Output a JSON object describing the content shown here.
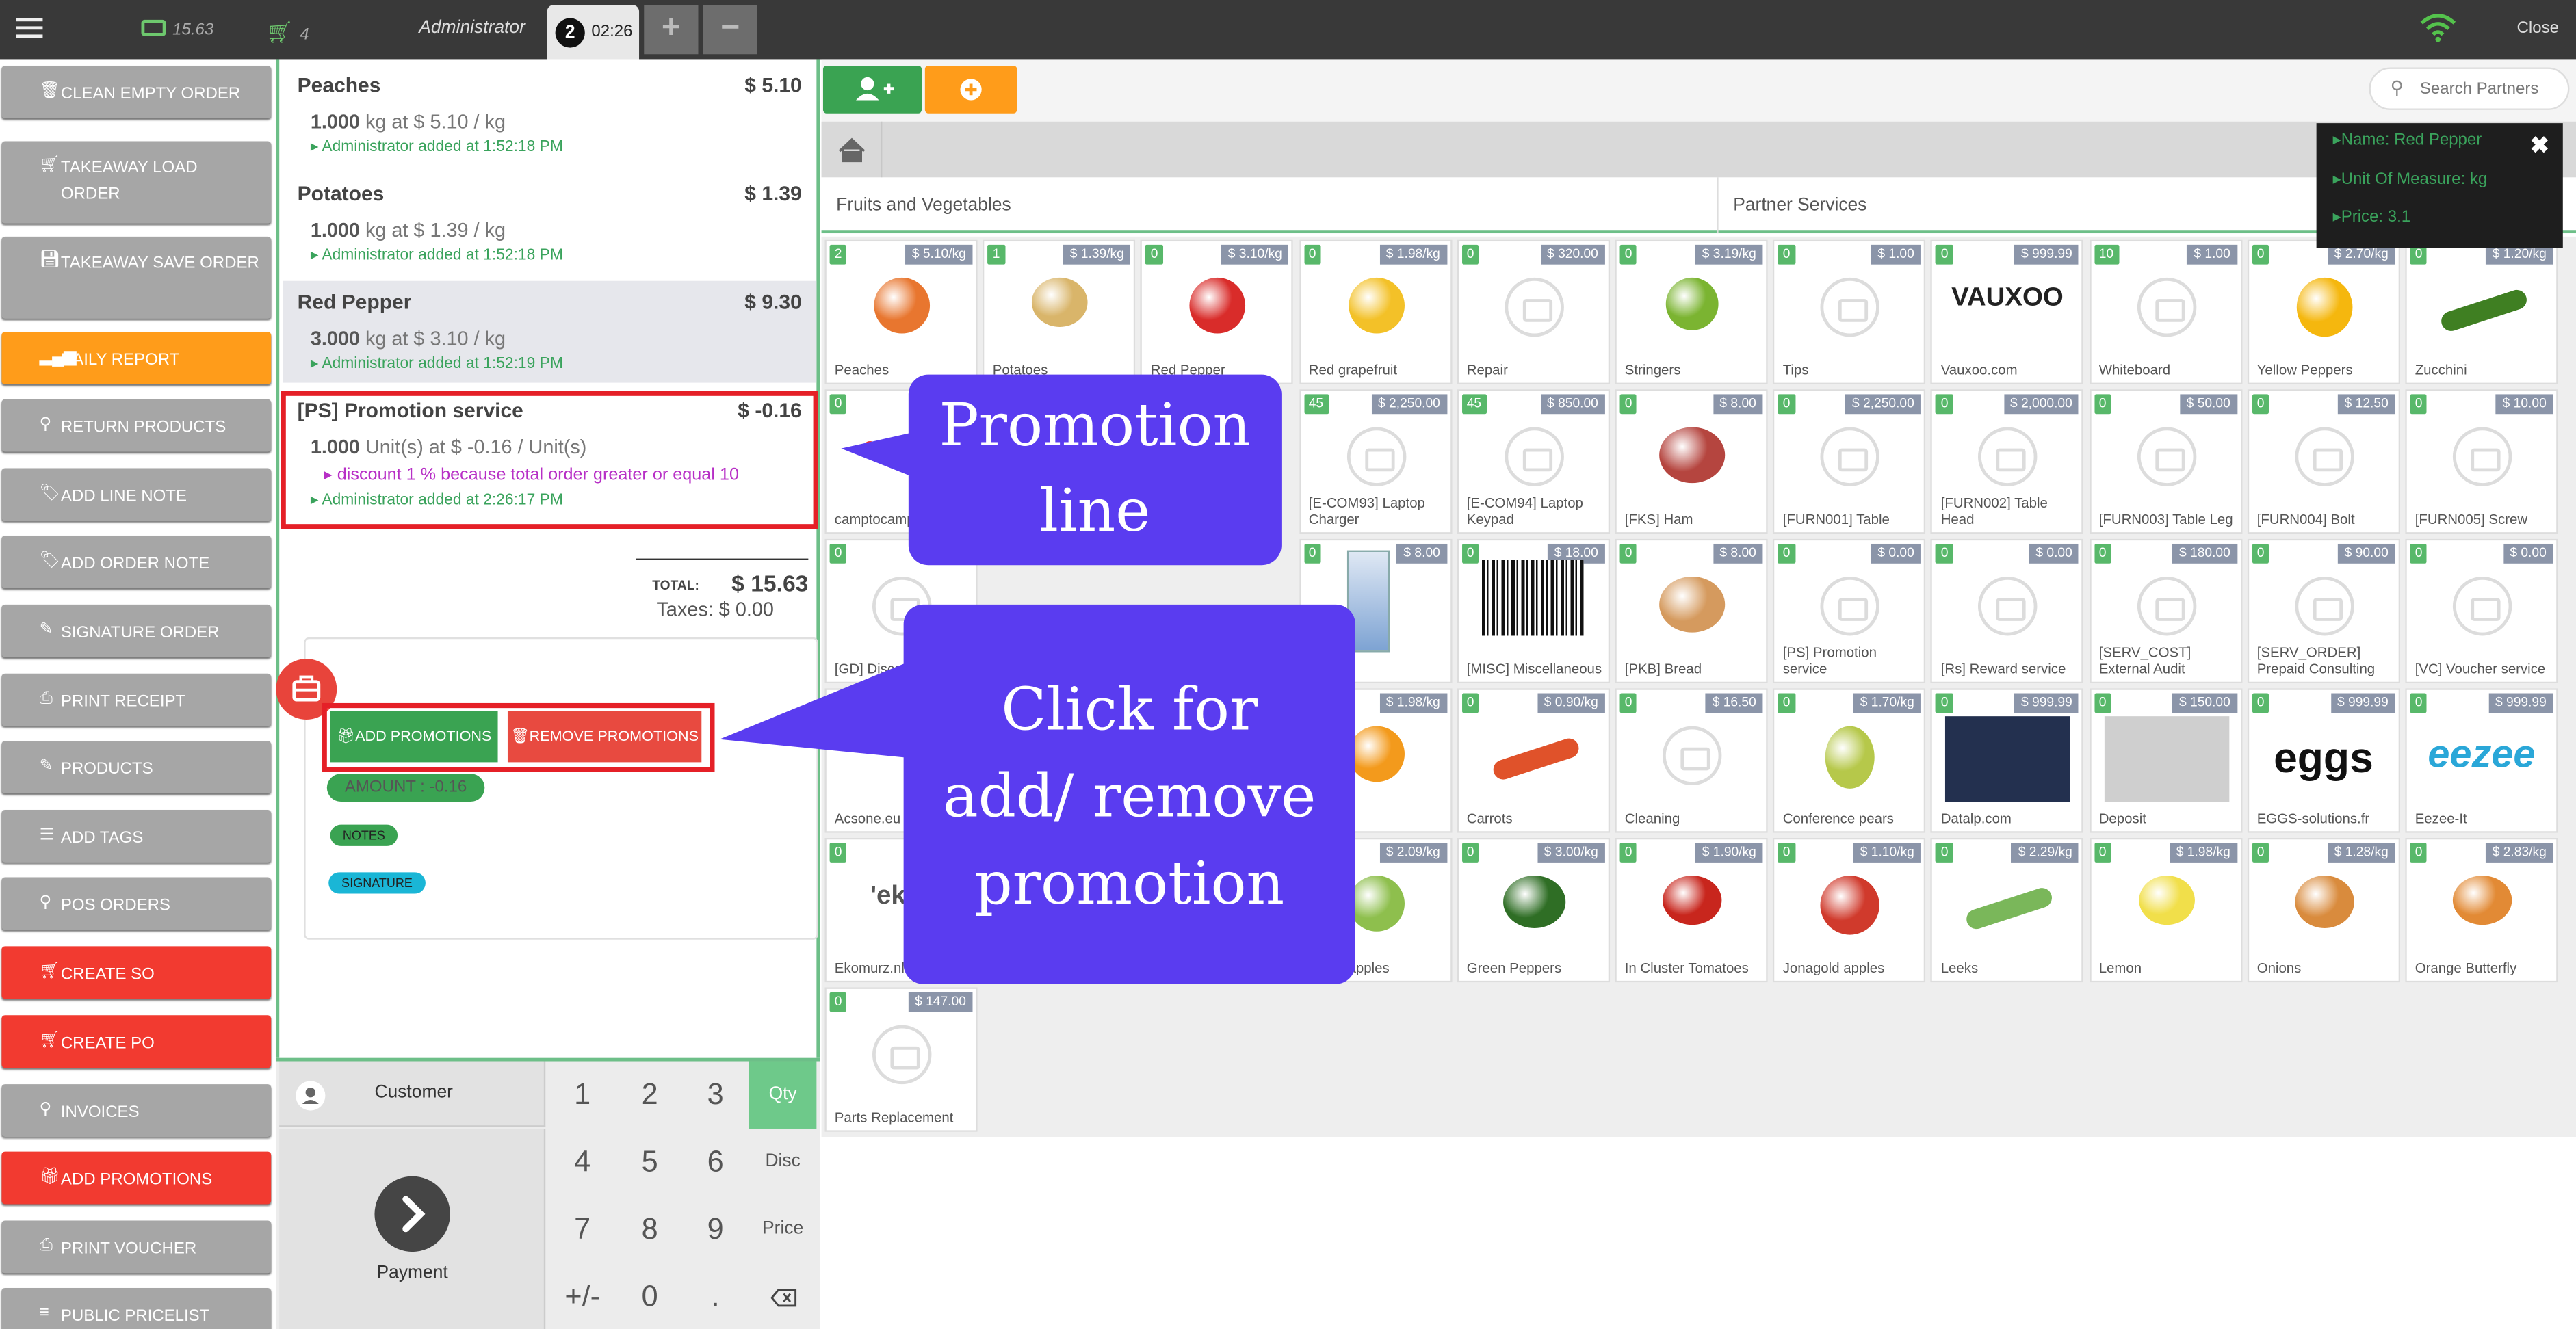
{
  "topbar": {
    "cash_value": "15.63",
    "cart_count": "4",
    "user": "Administrator",
    "order_number": "2",
    "order_time": "02:26",
    "add_tab": "+",
    "remove_tab": "−",
    "close_label": "Close"
  },
  "sidebar": {
    "items": [
      {
        "label": "CLEAN EMPTY ORDER",
        "icon": "trash-icon"
      },
      {
        "label": "TAKEAWAY LOAD ORDER",
        "icon": "cart-icon"
      },
      {
        "label": "TAKEAWAY SAVE ORDER",
        "icon": "save-icon"
      },
      {
        "label": "DAILY REPORT",
        "icon": "chart-icon"
      },
      {
        "label": "RETURN PRODUCTS",
        "icon": "search-icon"
      },
      {
        "label": "ADD LINE NOTE",
        "icon": "tag-icon"
      },
      {
        "label": "ADD ORDER NOTE",
        "icon": "tag-icon"
      },
      {
        "label": "SIGNATURE ORDER",
        "icon": "edit-icon"
      },
      {
        "label": "PRINT RECEIPT",
        "icon": "print-icon"
      },
      {
        "label": "PRODUCTS",
        "icon": "edit-icon"
      },
      {
        "label": "ADD TAGS",
        "icon": "sliders-icon"
      },
      {
        "label": "POS ORDERS",
        "icon": "search-icon"
      },
      {
        "label": "CREATE SO",
        "icon": "cart-icon"
      },
      {
        "label": "CREATE PO",
        "icon": "cart-icon"
      },
      {
        "label": "INVOICES",
        "icon": "search-icon"
      },
      {
        "label": "ADD PROMOTIONS",
        "icon": "gift-icon"
      },
      {
        "label": "PRINT VOUCHER",
        "icon": "print-icon"
      },
      {
        "label": "PUBLIC PRICELIST",
        "icon": "list-icon"
      }
    ]
  },
  "order": {
    "lines": [
      {
        "name": "Peaches",
        "price": "$ 5.10",
        "qty": "1.000",
        "qty_text": "kg at $ 5.10 / kg",
        "note": "Administrator added at 1:52:18 PM"
      },
      {
        "name": "Potatoes",
        "price": "$ 1.39",
        "qty": "1.000",
        "qty_text": "kg at $ 1.39 / kg",
        "note": "Administrator added at 1:52:18 PM"
      },
      {
        "name": "Red Pepper",
        "price": "$ 9.30",
        "qty": "3.000",
        "qty_text": "kg at $ 3.10 / kg",
        "note": "Administrator added at 1:52:19 PM"
      },
      {
        "name": "[PS] Promotion service",
        "price": "$ -0.16",
        "qty": "1.000",
        "qty_text": "Unit(s) at $ -0.16 / Unit(s)",
        "discount": "discount 1 % because total order greater or equal 10",
        "note": "Administrator added at 2:26:17 PM"
      }
    ],
    "total_label": "TOTAL:",
    "total": "$ 15.63",
    "taxes": "Taxes: $ 0.00",
    "add_promotions": "ADD PROMOTIONS",
    "remove_promotions": "REMOVE PROMOTIONS",
    "amount": "AMOUNT : -0.16",
    "notes": "NOTES",
    "signature": "SIGNATURE"
  },
  "numpad": {
    "customer": "Customer",
    "payment": "Payment",
    "keys": [
      "1",
      "2",
      "3",
      "4",
      "5",
      "6",
      "7",
      "8",
      "9",
      "+/-",
      "0",
      "."
    ],
    "qty": "Qty",
    "disc": "Disc",
    "price": "Price"
  },
  "products_panel": {
    "search_placeholder": "Search Partners",
    "categories": [
      "Fruits and Vegetables",
      "Partner Services"
    ],
    "tooltip": {
      "name": "Name: Red Pepper",
      "uom": "Unit Of Measure: kg",
      "price": "Price: 3.1"
    },
    "products": [
      {
        "name": "Peaches",
        "badge": "2",
        "price": "$ 5.10/kg"
      },
      {
        "name": "Potatoes",
        "badge": "1",
        "price": "$ 1.39/kg"
      },
      {
        "name": "Red Pepper",
        "badge": "0",
        "price": "$ 3.10/kg"
      },
      {
        "name": "Red grapefruit",
        "badge": "0",
        "price": "$ 1.98/kg"
      },
      {
        "name": "Repair",
        "badge": "0",
        "price": "$ 320.00"
      },
      {
        "name": "Stringers",
        "badge": "0",
        "price": "$ 3.19/kg"
      },
      {
        "name": "Tips",
        "badge": "0",
        "price": "$ 1.00"
      },
      {
        "name": "Vauxoo.com",
        "badge": "0",
        "price": "$ 999.99"
      },
      {
        "name": "Whiteboard",
        "badge": "10",
        "price": "$ 1.00"
      },
      {
        "name": "Yellow Peppers",
        "badge": "0",
        "price": "$ 2.70/kg"
      },
      {
        "name": "Zucchini",
        "badge": "0",
        "price": "$ 1.20/kg"
      },
      {
        "name": "camptocamp",
        "badge": "0",
        "price": ""
      },
      {
        "name": "",
        "badge": "",
        "price": ""
      },
      {
        "name": "",
        "badge": "",
        "price": ""
      },
      {
        "name": "[E-COM93] Laptop Charger",
        "badge": "45",
        "price": "$ 2,250.00"
      },
      {
        "name": "[E-COM94] Laptop Keypad",
        "badge": "45",
        "price": "$ 850.00"
      },
      {
        "name": "[FKS] Ham",
        "badge": "0",
        "price": "$ 8.00"
      },
      {
        "name": "[FURN001] Table",
        "badge": "0",
        "price": "$ 2,250.00"
      },
      {
        "name": "[FURN002] Table Head",
        "badge": "0",
        "price": "$ 2,000.00"
      },
      {
        "name": "[FURN003] Table Leg",
        "badge": "0",
        "price": "$ 50.00"
      },
      {
        "name": "[FURN004] Bolt",
        "badge": "0",
        "price": "$ 12.50"
      },
      {
        "name": "[FURN005] Screw",
        "badge": "0",
        "price": "$ 10.00"
      },
      {
        "name": "[GD] Discou",
        "badge": "0",
        "price": ""
      },
      {
        "name": "",
        "badge": "",
        "price": ""
      },
      {
        "name": "",
        "badge": "",
        "price": ""
      },
      {
        "name": "w milk",
        "badge": "0",
        "price": "$ 8.00"
      },
      {
        "name": "[MISC] Miscellaneous",
        "badge": "0",
        "price": "$ 18.00"
      },
      {
        "name": "[PKB] Bread",
        "badge": "0",
        "price": "$ 8.00"
      },
      {
        "name": "[PS] Promotion service",
        "badge": "0",
        "price": "$ 0.00"
      },
      {
        "name": "[Rs] Reward service",
        "badge": "0",
        "price": "$ 0.00"
      },
      {
        "name": "[SERV_COST] External Audit",
        "badge": "0",
        "price": "$ 180.00"
      },
      {
        "name": "[SERV_ORDER] Prepaid Consulting",
        "badge": "0",
        "price": "$ 90.00"
      },
      {
        "name": "[VC] Voucher service",
        "badge": "0",
        "price": "$ 0.00"
      },
      {
        "name": "Acsone.eu",
        "badge": "0",
        "price": ""
      },
      {
        "name": "",
        "badge": "",
        "price": ""
      },
      {
        "name": "",
        "badge": "",
        "price": ""
      },
      {
        "name": "nges",
        "badge": "",
        "price": "$ 1.98/kg"
      },
      {
        "name": "Carrots",
        "badge": "0",
        "price": "$ 0.90/kg"
      },
      {
        "name": "Cleaning",
        "badge": "0",
        "price": "$ 16.50"
      },
      {
        "name": "Conference pears",
        "badge": "0",
        "price": "$ 1.70/kg"
      },
      {
        "name": "Datalp.com",
        "badge": "0",
        "price": "$ 999.99"
      },
      {
        "name": "Deposit",
        "badge": "0",
        "price": "$ 150.00"
      },
      {
        "name": "EGGS-solutions.fr",
        "badge": "0",
        "price": "$ 999.99"
      },
      {
        "name": "Eezee-It",
        "badge": "0",
        "price": "$ 999.99"
      },
      {
        "name": "Ekomurz.nl",
        "badge": "0",
        "price": ""
      },
      {
        "name": "",
        "badge": "",
        "price": ""
      },
      {
        "name": "",
        "badge": "",
        "price": ""
      },
      {
        "name": "Smith apples",
        "badge": "",
        "price": "$ 2.09/kg"
      },
      {
        "name": "Green Peppers",
        "badge": "0",
        "price": "$ 3.00/kg"
      },
      {
        "name": "In Cluster Tomatoes",
        "badge": "0",
        "price": "$ 1.90/kg"
      },
      {
        "name": "Jonagold apples",
        "badge": "0",
        "price": "$ 1.10/kg"
      },
      {
        "name": "Leeks",
        "badge": "0",
        "price": "$ 2.29/kg"
      },
      {
        "name": "Lemon",
        "badge": "0",
        "price": "$ 1.98/kg"
      },
      {
        "name": "Onions",
        "badge": "0",
        "price": "$ 1.28/kg"
      },
      {
        "name": "Orange Butterfly",
        "badge": "0",
        "price": "$ 2.83/kg"
      },
      {
        "name": "Parts Replacement",
        "badge": "0",
        "price": "$ 147.00"
      }
    ]
  },
  "callouts": {
    "promotion_line": "Promotion line",
    "click_promotion": "Click for add/ remove promotion"
  },
  "logos": {
    "vauxoo": "VAUXOO",
    "eggs": "eggs",
    "eezee": "eezee",
    "eko": "'ekor",
    "campto": "campt"
  }
}
